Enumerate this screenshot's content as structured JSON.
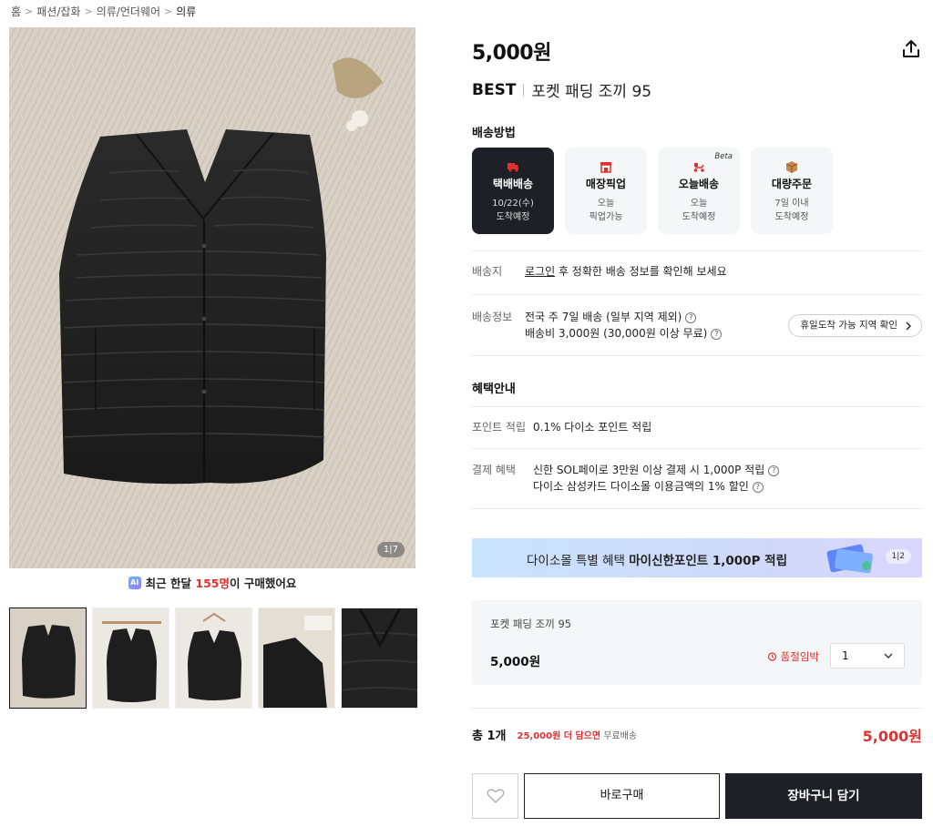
{
  "breadcrumb": {
    "items": [
      "홈",
      "패션/잡화",
      "의류/언더웨어",
      "의류"
    ],
    "separator": ">"
  },
  "gallery": {
    "counter": "1|7",
    "thumbnail_count": 5
  },
  "purchase_notice": {
    "ai_badge": "AI",
    "prefix": "최근 한달 ",
    "count": "155명",
    "suffix": "이 구매했어요"
  },
  "product": {
    "price": "5,000원",
    "badge": "BEST",
    "name": "포켓 패딩 조끼 95"
  },
  "shipping": {
    "title": "배송방법",
    "options": [
      {
        "label": "택배배송",
        "line1": "10/22(수)",
        "line2": "도착예정",
        "icon": "truck-icon",
        "active": true
      },
      {
        "label": "매장픽업",
        "line1": "오늘",
        "line2": "픽업가능",
        "icon": "store-icon",
        "active": false
      },
      {
        "label": "오늘배송",
        "line1": "오늘",
        "line2": "도착예정",
        "icon": "scooter-icon",
        "active": false,
        "tag": "Beta"
      },
      {
        "label": "대량주문",
        "line1": "7일 이내",
        "line2": "도착예정",
        "icon": "box-icon",
        "active": false
      }
    ],
    "destination_label": "배송지",
    "destination_link": "로그인",
    "destination_text": " 후 정확한 배송 정보를 확인해 보세요",
    "info_label": "배송정보",
    "info_line1": "전국 주 7일 배송 (일부 지역 제외)",
    "info_line2": "배송비 3,000원 (30,000원 이상 무료)",
    "holiday_button": "휴일도착 가능 지역 확인"
  },
  "benefits": {
    "title": "혜택안내",
    "point_label": "포인트 적립",
    "point_value": "0.1% 다이소 포인트 적립",
    "payment_label": "결제 혜택",
    "payment_line1": "신한 SOL페이로 3만원 이상 결제 시 1,000P 적립",
    "payment_line2": "다이소 삼성카드 다이소몰 이용금액의 1% 할인"
  },
  "banner": {
    "text_plain": "다이소몰 특별 혜택 ",
    "text_bold": "마이신한포인트 1,000P 적립",
    "counter": "1|2"
  },
  "option_box": {
    "name": "포켓 패딩 조끼 95",
    "price": "5,000원",
    "soldout": "품절임박",
    "quantity": "1"
  },
  "total": {
    "count": "총 1개",
    "more": "25,000원 더 담으면",
    "free": " 무료배송",
    "price": "5,000원"
  },
  "buttons": {
    "buy_now": "바로구매",
    "add_cart": "장바구니 담기"
  },
  "colors": {
    "accent_red": "#e0302f",
    "dark": "#1d2127"
  }
}
